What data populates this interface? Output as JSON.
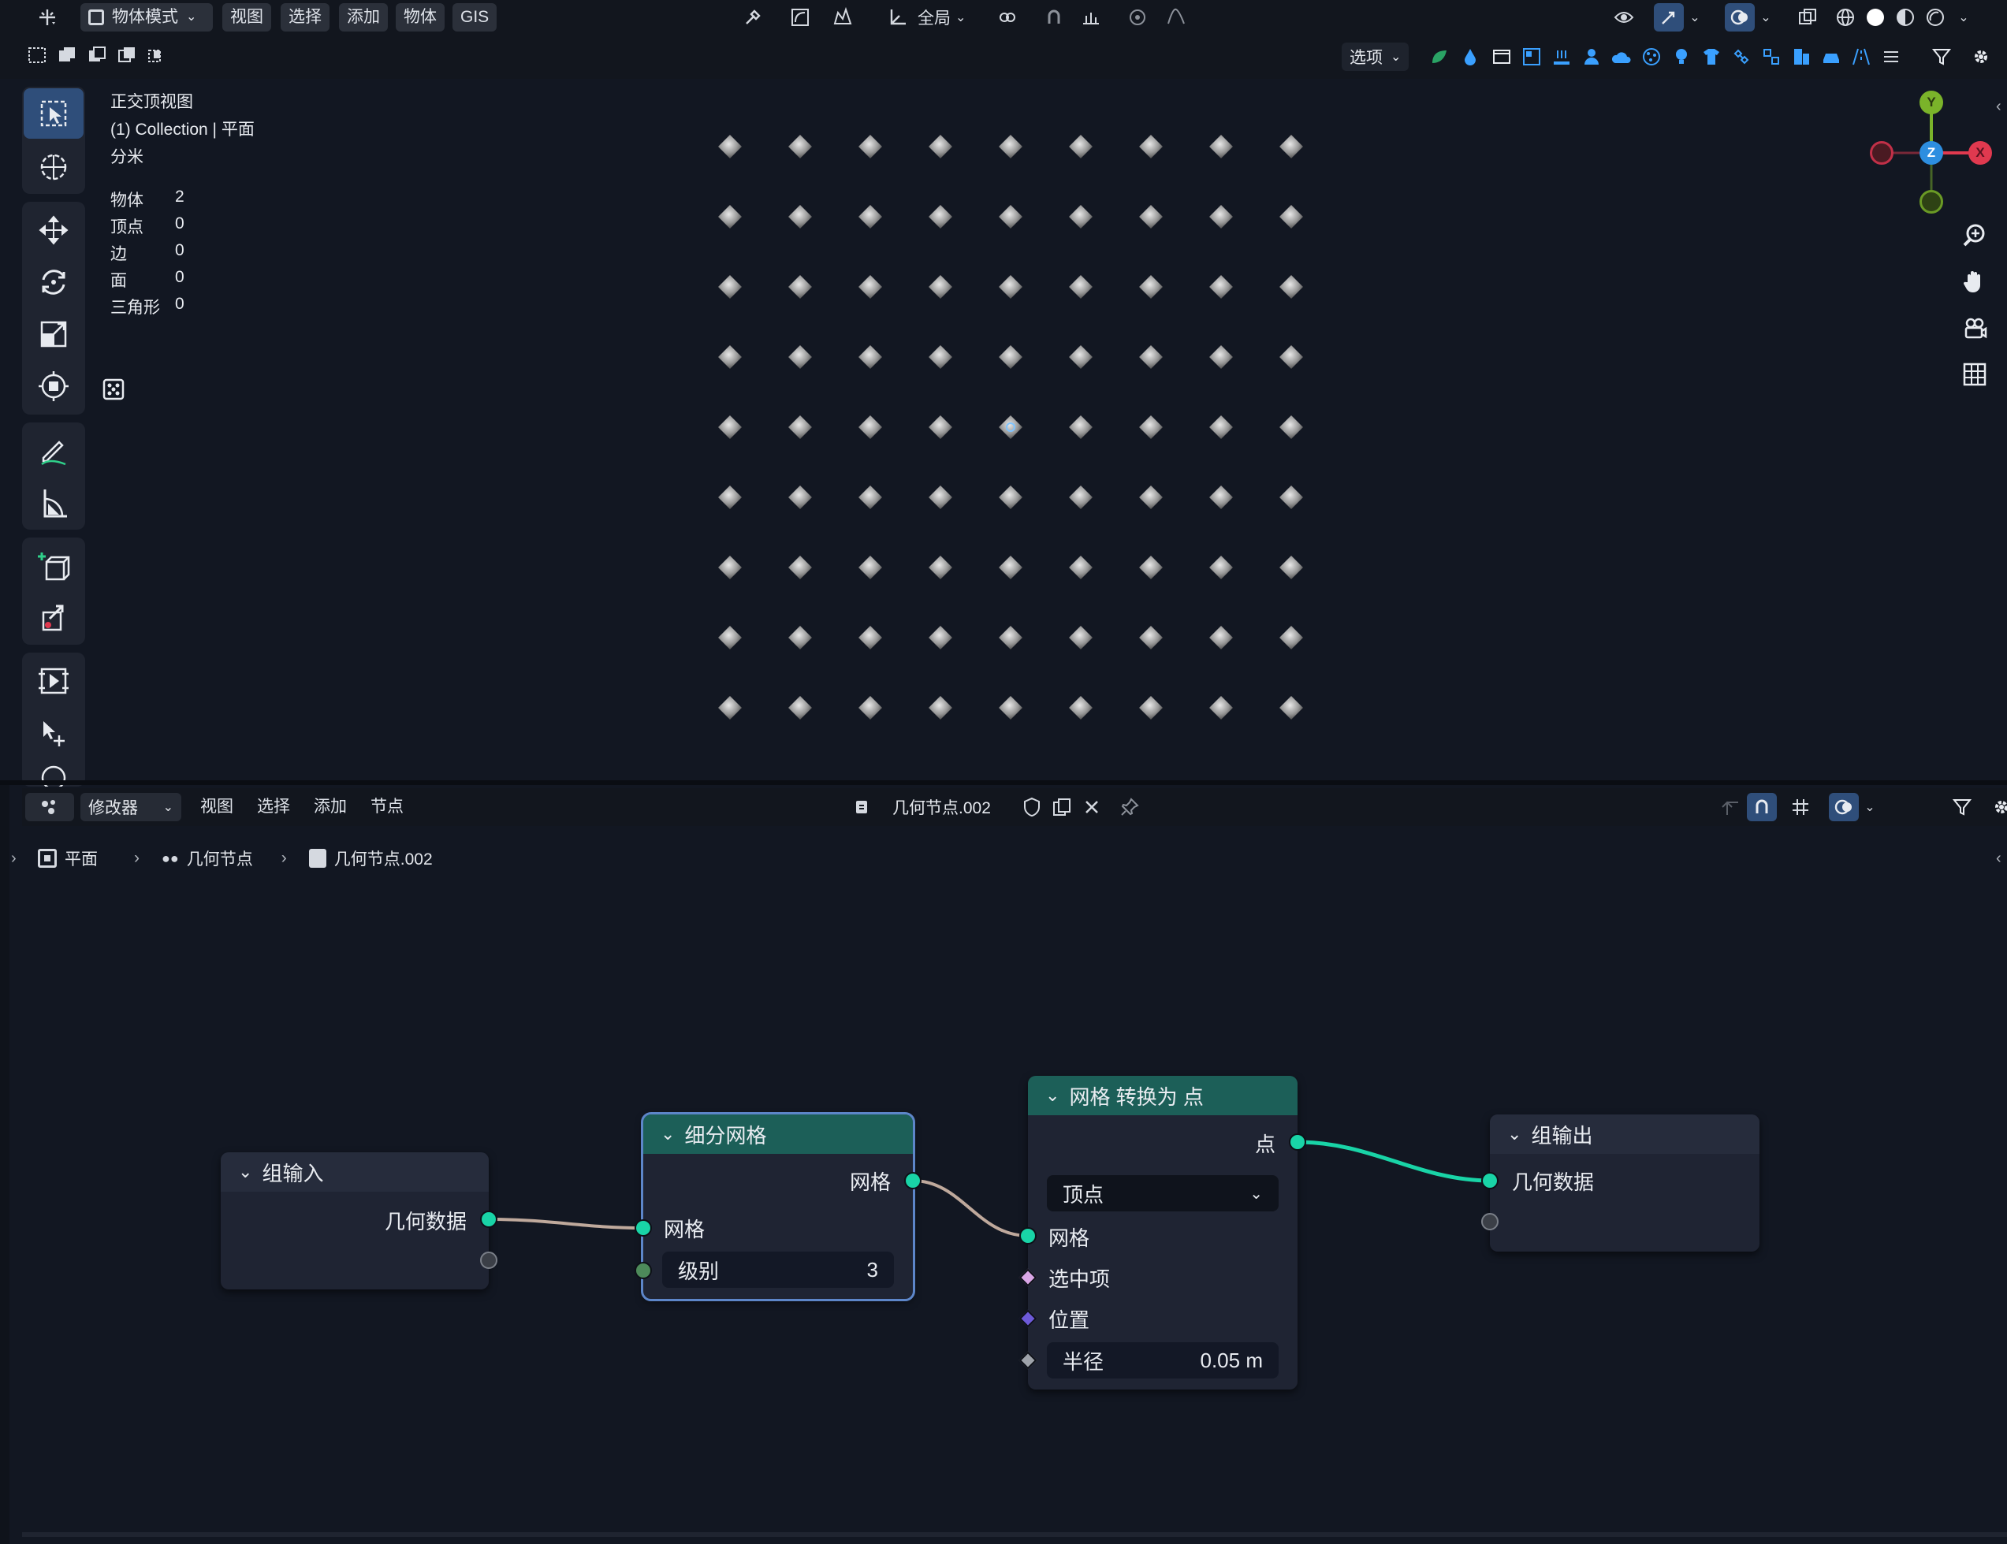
{
  "viewport_header": {
    "mode_label": "物体模式",
    "menus": [
      "视图",
      "选择",
      "添加",
      "物体",
      "GIS"
    ],
    "transform_orientation": "全局",
    "options_label": "选项"
  },
  "viewport_overlay": {
    "view_name": "正交顶视图",
    "collection_line": "(1) Collection | 平面",
    "units": "分米",
    "stats": [
      {
        "label": "物体",
        "value": "2"
      },
      {
        "label": "顶点",
        "value": "0"
      },
      {
        "label": "边",
        "value": "0"
      },
      {
        "label": "面",
        "value": "0"
      },
      {
        "label": "三角形",
        "value": "0"
      }
    ]
  },
  "gizmo": {
    "y": "Y",
    "z": "Z",
    "x": "X"
  },
  "node_editor_header": {
    "mode_label": "修改器",
    "menus": [
      "视图",
      "选择",
      "添加",
      "节点"
    ],
    "node_group_name": "几何节点.002"
  },
  "breadcrumb": {
    "items": [
      "平面",
      "几何节点",
      "几何节点.002"
    ]
  },
  "nodes": {
    "group_input": {
      "title": "组输入",
      "output": "几何数据"
    },
    "subdivide": {
      "title": "细分网格",
      "output": "网格",
      "input": "网格",
      "level_label": "级别",
      "level_value": "3"
    },
    "mesh_to_points": {
      "title": "网格 转换为 点",
      "output": "点",
      "mode": "顶点",
      "inputs": [
        "网格",
        "选中项",
        "位置"
      ],
      "radius_label": "半径",
      "radius_value": "0.05 m"
    },
    "group_output": {
      "title": "组输出",
      "input": "几何数据"
    }
  },
  "colors": {
    "geometry_socket": "#19d4a7",
    "selected_node_outline": "#5d86c9",
    "node_header_teal": "#1c5f58",
    "gizmo_x": "#e0394f",
    "gizmo_y": "#7ab32a",
    "gizmo_z": "#2d8ee0"
  }
}
